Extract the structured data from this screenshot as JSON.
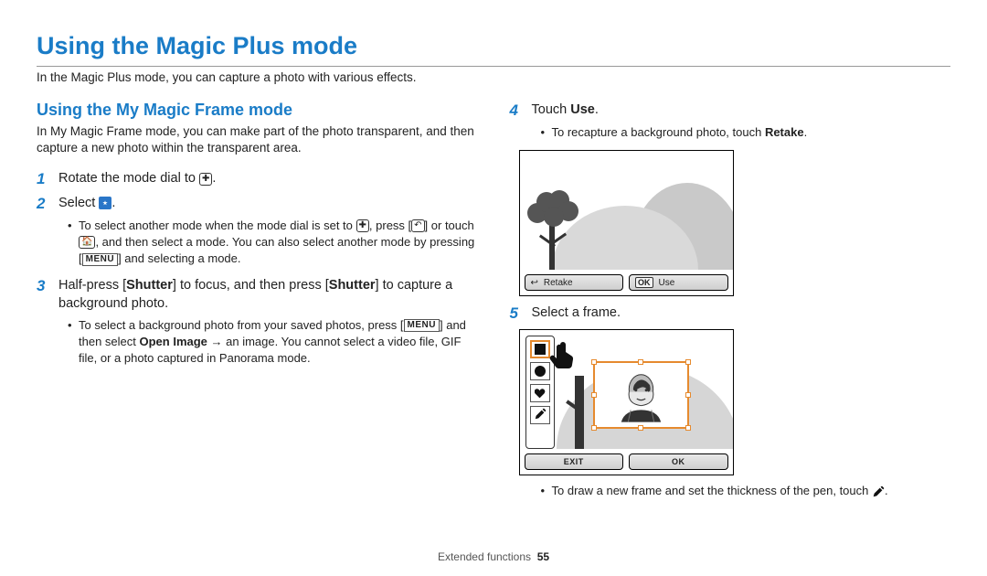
{
  "title": "Using the Magic Plus mode",
  "intro": "In the Magic Plus mode, you can capture a photo with various effects.",
  "subsection_title": "Using the My Magic Frame mode",
  "subsection_intro": "In My Magic Frame mode, you can make part of the photo transparent, and then capture a new photo within the transparent area.",
  "steps": {
    "s1": {
      "num": "1",
      "text_a": "Rotate the mode dial to ",
      "text_b": "."
    },
    "s2": {
      "num": "2",
      "text_a": "Select ",
      "text_b": ".",
      "bullet_a": "To select another mode when the mode dial is set to ",
      "bullet_b": ", press [",
      "bullet_c": "] or touch ",
      "bullet_d": ", and then select a mode. You can also select another mode by pressing [",
      "bullet_e": "] and selecting a mode."
    },
    "s3": {
      "num": "3",
      "t1": "Half-press [",
      "b1": "Shutter",
      "t2": "] to focus, and then press [",
      "b2": "Shutter",
      "t3": "] to capture a background photo.",
      "bul_a": "To select a background photo from your saved photos, press [",
      "bul_b": "] and then select ",
      "bul_bold": "Open Image",
      "bul_c": " → an image. You cannot select a video file, GIF file, or a photo captured in Panorama mode."
    },
    "s4": {
      "num": "4",
      "t1": "Touch ",
      "b1": "Use",
      "t2": ".",
      "bul_a": "To recapture a background photo, touch ",
      "bul_bold": "Retake",
      "bul_b": "."
    },
    "s5": {
      "num": "5",
      "text": "Select a frame.",
      "bul_a": "To draw a new frame and set the thickness of the pen, touch ",
      "bul_b": "."
    }
  },
  "illus1": {
    "retake": "Retake",
    "ok": "OK",
    "use": "Use"
  },
  "illus2": {
    "exit": "EXIT",
    "ok": "OK"
  },
  "menu_label": "MENU",
  "footer_section": "Extended functions",
  "footer_page": "55"
}
